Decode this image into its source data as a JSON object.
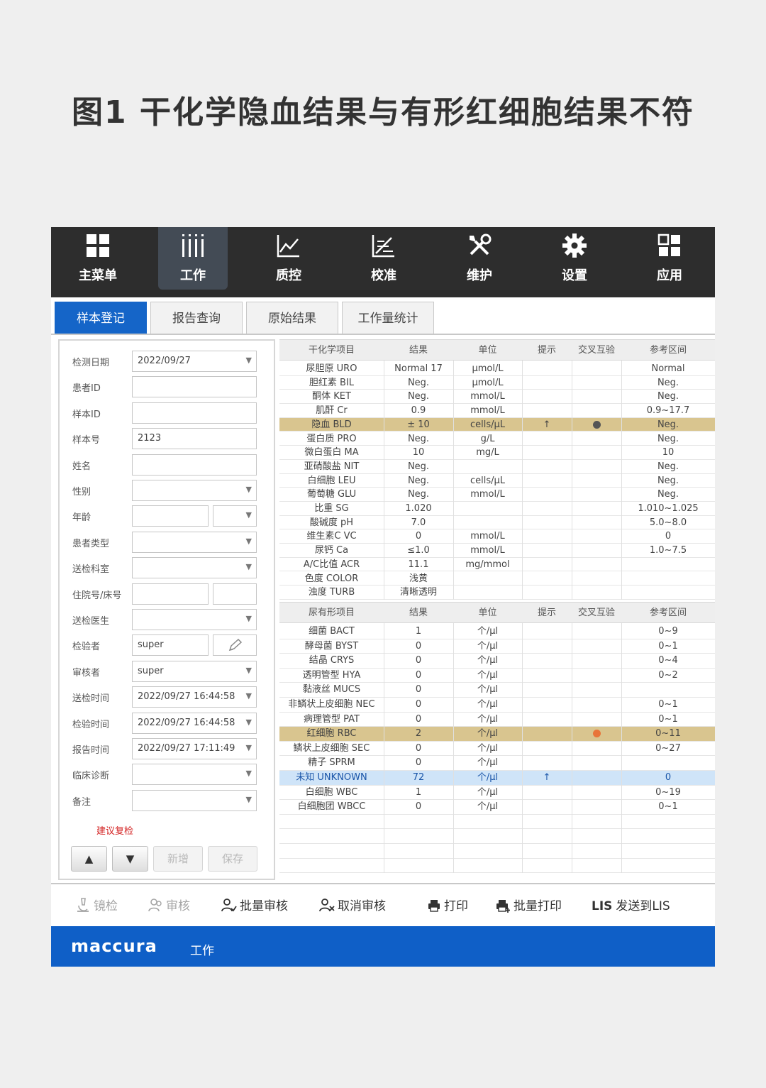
{
  "title": "图1  干化学隐血结果与有形红细胞结果不符",
  "nav": [
    {
      "label": "主菜单",
      "icon": "grid-icon"
    },
    {
      "label": "工作",
      "icon": "bars-icon"
    },
    {
      "label": "质控",
      "icon": "line-chart-icon"
    },
    {
      "label": "校准",
      "icon": "calibration-icon"
    },
    {
      "label": "维护",
      "icon": "tools-icon"
    },
    {
      "label": "设置",
      "icon": "gear-icon"
    },
    {
      "label": "应用",
      "icon": "apps-icon"
    }
  ],
  "tabs": [
    "样本登记",
    "报告查询",
    "原始结果",
    "工作量统计"
  ],
  "form": [
    {
      "label": "检测日期",
      "value": "2022/09/27",
      "dropdown": true
    },
    {
      "label": "患者ID",
      "value": ""
    },
    {
      "label": "样本ID",
      "value": ""
    },
    {
      "label": "样本号",
      "value": "2123"
    },
    {
      "label": "姓名",
      "value": ""
    },
    {
      "label": "性别",
      "value": "",
      "dropdown": true
    },
    {
      "label": "年龄",
      "value": "",
      "split": "dropdown"
    },
    {
      "label": "患者类型",
      "value": "",
      "dropdown": true
    },
    {
      "label": "送检科室",
      "value": "",
      "dropdown": true
    },
    {
      "label": "住院号/床号",
      "value": "",
      "split": "text"
    },
    {
      "label": "送检医生",
      "value": "",
      "dropdown": true
    },
    {
      "label": "检验者",
      "value": "super",
      "split": "pencil"
    },
    {
      "label": "审核者",
      "value": "super",
      "dropdown": true
    },
    {
      "label": "送检时间",
      "value": "2022/09/27 16:44:58",
      "dropdown": true
    },
    {
      "label": "检验时间",
      "value": "2022/09/27 16:44:58",
      "dropdown": true
    },
    {
      "label": "报告时间",
      "value": "2022/09/27 17:11:49",
      "dropdown": true
    },
    {
      "label": "临床诊断",
      "value": "",
      "dropdown": true
    },
    {
      "label": "备注",
      "value": "",
      "dropdown": true
    }
  ],
  "recheck_hint": "建议复检",
  "buttons": {
    "up": "▲",
    "down": "▼",
    "add": "新增",
    "save": "保存"
  },
  "dry_table": {
    "headers": [
      "干化学项目",
      "结果",
      "单位",
      "提示",
      "交叉互验",
      "参考区间"
    ],
    "rows": [
      [
        "尿胆原 URO",
        "Normal 17",
        "μmol/L",
        "",
        "",
        "Normal"
      ],
      [
        "胆红素 BIL",
        "Neg.",
        "μmol/L",
        "",
        "",
        "Neg."
      ],
      [
        "酮体 KET",
        "Neg.",
        "mmol/L",
        "",
        "",
        "Neg."
      ],
      [
        "肌酐 Cr",
        "0.9",
        "mmol/L",
        "",
        "",
        "0.9~17.7"
      ],
      [
        "隐血 BLD",
        "± 10",
        "cells/μL",
        "↑",
        "●",
        "Neg."
      ],
      [
        "蛋白质 PRO",
        "Neg.",
        "g/L",
        "",
        "",
        "Neg."
      ],
      [
        "微白蛋白 MA",
        "10",
        "mg/L",
        "",
        "",
        "10"
      ],
      [
        "亚硝酸盐 NIT",
        "Neg.",
        "",
        "",
        "",
        "Neg."
      ],
      [
        "白细胞 LEU",
        "Neg.",
        "cells/μL",
        "",
        "",
        "Neg."
      ],
      [
        "葡萄糖 GLU",
        "Neg.",
        "mmol/L",
        "",
        "",
        "Neg."
      ],
      [
        "比重 SG",
        "1.020",
        "",
        "",
        "",
        "1.010~1.025"
      ],
      [
        "酸碱度 pH",
        "7.0",
        "",
        "",
        "",
        "5.0~8.0"
      ],
      [
        "维生素C VC",
        "0",
        "mmol/L",
        "",
        "",
        "0"
      ],
      [
        "尿钙 Ca",
        "≤1.0",
        "mmol/L",
        "",
        "",
        "1.0~7.5"
      ],
      [
        "A/C比值 ACR",
        "11.1",
        "mg/mmol",
        "",
        "",
        ""
      ],
      [
        "色度 COLOR",
        "浅黄",
        "",
        "",
        "",
        ""
      ],
      [
        "浊度 TURB",
        "清晰透明",
        "",
        "",
        "",
        ""
      ]
    ],
    "highlight_row": 4,
    "dot_color": "#555555"
  },
  "sed_table": {
    "headers": [
      "尿有形项目",
      "结果",
      "单位",
      "提示",
      "交叉互验",
      "参考区间"
    ],
    "rows": [
      [
        "细菌 BACT",
        "1",
        "个/μl",
        "",
        "",
        "0~9"
      ],
      [
        "酵母菌 BYST",
        "0",
        "个/μl",
        "",
        "",
        "0~1"
      ],
      [
        "结晶 CRYS",
        "0",
        "个/μl",
        "",
        "",
        "0~4"
      ],
      [
        "透明管型 HYA",
        "0",
        "个/μl",
        "",
        "",
        "0~2"
      ],
      [
        "黏液丝 MUCS",
        "0",
        "个/μl",
        "",
        "",
        ""
      ],
      [
        "非鳞状上皮细胞 NEC",
        "0",
        "个/μl",
        "",
        "",
        "0~1"
      ],
      [
        "病理管型 PAT",
        "0",
        "个/μl",
        "",
        "",
        "0~1"
      ],
      [
        "红细胞 RBC",
        "2",
        "个/μl",
        "",
        "●",
        "0~11"
      ],
      [
        "鳞状上皮细胞 SEC",
        "0",
        "个/μl",
        "",
        "",
        "0~27"
      ],
      [
        "精子 SPRM",
        "0",
        "个/μl",
        "",
        "",
        ""
      ],
      [
        "未知 UNKNOWN",
        "72",
        "个/μl",
        "↑",
        "",
        "0"
      ],
      [
        "白细胞 WBC",
        "1",
        "个/μl",
        "",
        "",
        "0~19"
      ],
      [
        "白细胞团 WBCC",
        "0",
        "个/μl",
        "",
        "",
        "0~1"
      ]
    ],
    "highlight_row": 7,
    "blue_row": 10,
    "empty_rows": 4,
    "dot_color": "#e8753a"
  },
  "actions": [
    {
      "label": "镜检",
      "icon": "microscope-icon",
      "enabled": false
    },
    {
      "label": "审核",
      "icon": "user-review-icon",
      "enabled": false
    },
    {
      "label": "批量审核",
      "icon": "batch-review-icon",
      "enabled": true
    },
    {
      "label": "取消审核",
      "icon": "cancel-review-icon",
      "enabled": true
    },
    {
      "label": "打印",
      "icon": "printer-icon",
      "enabled": true
    },
    {
      "label": "批量打印",
      "icon": "batch-print-icon",
      "enabled": true
    },
    {
      "label": "发送到LIS",
      "icon": "lis-icon",
      "icon_text": "LIS",
      "enabled": true
    }
  ],
  "footer": {
    "brand": "maccura",
    "label": "工作"
  },
  "colors": {
    "nav_bg": "#2d2d2d",
    "active_tab": "#1565c8",
    "footer_bg": "#0f5fc7",
    "highlight_gold": "#d9c58f",
    "highlight_blue": "#cfe4f8",
    "warn_red": "#d32020"
  }
}
